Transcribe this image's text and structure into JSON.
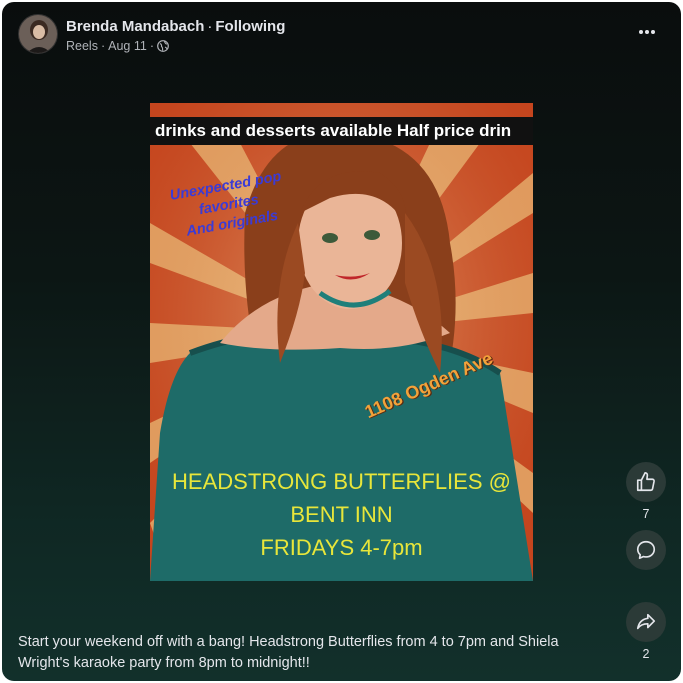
{
  "post": {
    "author": "Brenda Mandabach",
    "separator": "·",
    "follow_status": "Following",
    "source": "Reels",
    "date": "Aug 11",
    "meta_dot_1": "·",
    "meta_dot_2": "·",
    "privacy_icon": "globe-icon",
    "more_icon": "more-horizontal-icon"
  },
  "poster": {
    "ticker_text": "drinks and desserts available  Half price drin",
    "tagline": [
      "Unexpected pop",
      "favorites",
      "And originals"
    ],
    "address": "1108 Ogden Ave",
    "headline": [
      "HEADSTRONG BUTTERFLIES @",
      "BENT INN",
      "FRIDAYS 4-7pm"
    ],
    "colors": {
      "background": "#c9481f",
      "rays": "#f1c77e",
      "headline": "#e8e63a",
      "tagline": "#3b3bd6",
      "address": "#f2a23a",
      "dress": "#1e6b68"
    }
  },
  "actions": {
    "like_icon": "thumbs-up-icon",
    "like_count": "7",
    "comment_icon": "comment-bubble-icon",
    "share_icon": "share-arrow-icon",
    "share_count": "2"
  },
  "caption": "Start your weekend off with a bang! Headstrong Butterflies from 4 to 7pm and Shiela Wright's karaoke party from 8pm to midnight!!"
}
